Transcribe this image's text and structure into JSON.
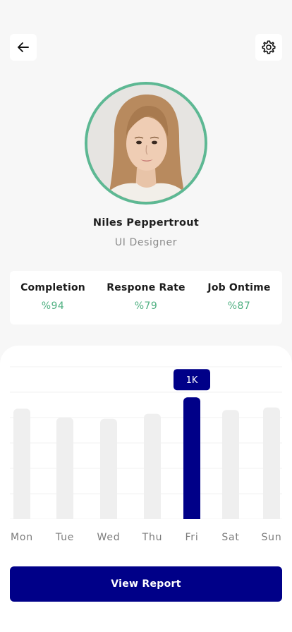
{
  "header": {
    "back_icon": "arrow-left-icon",
    "settings_icon": "gear-icon"
  },
  "profile": {
    "name": "Niles Peppertrout",
    "role": "UI Designer",
    "avatar_ring_color": "#5db893"
  },
  "stats": [
    {
      "label": "Completion",
      "value": "%94"
    },
    {
      "label": "Respone Rate",
      "value": "%79"
    },
    {
      "label": "Job Ontime",
      "value": "%87"
    }
  ],
  "chart_data": {
    "type": "bar",
    "categories": [
      "Mon",
      "Tue",
      "Wed",
      "Thu",
      "Fri",
      "Sat",
      "Sun"
    ],
    "values": [
      0.87,
      0.8,
      0.79,
      0.83,
      0.96,
      0.86,
      0.88
    ],
    "highlighted_index": 4,
    "highlight_label": "1K",
    "ylim": [
      0,
      1.2
    ],
    "grid": true,
    "bar_color": "#efefef",
    "highlight_color": "#000088"
  },
  "actions": {
    "view_report_label": "View Report"
  },
  "colors": {
    "accent": "#000088",
    "positive": "#4fb081",
    "background": "#f7f7f7"
  }
}
